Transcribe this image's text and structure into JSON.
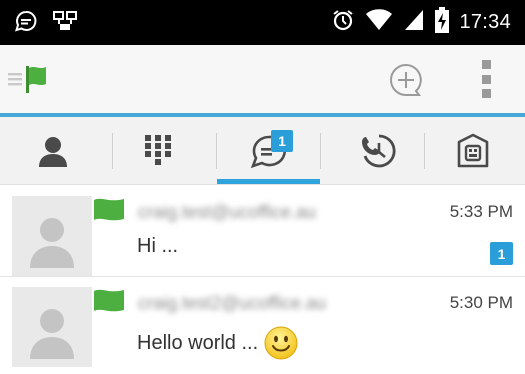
{
  "status_bar": {
    "time": "17:34",
    "icons": [
      "chat-bubble-icon",
      "network-icon",
      "alarm-icon",
      "wifi-icon",
      "signal-icon",
      "battery-charging-icon"
    ]
  },
  "action_bar": {
    "icons": [
      "drawer-menu-icon",
      "app-flag-icon",
      "compose-icon",
      "overflow-menu-icon"
    ],
    "brand_color": "#4caf3f"
  },
  "tabs": {
    "items": [
      {
        "icon": "contacts-icon"
      },
      {
        "icon": "dialpad-icon"
      },
      {
        "icon": "chats-icon",
        "badge": "1",
        "selected": true
      },
      {
        "icon": "call-history-icon"
      },
      {
        "icon": "directory-icon"
      }
    ],
    "accent": "#2ea3dc"
  },
  "conversations": [
    {
      "name": "craig.test@ucoffice.au",
      "time": "5:33 PM",
      "message": "Hi ...",
      "unread": "1",
      "status": "available"
    },
    {
      "name": "craig.test2@ucoffice.au",
      "time": "5:30 PM",
      "message": "Hello world ...",
      "emoji": "smiley-icon",
      "status": "available"
    }
  ]
}
